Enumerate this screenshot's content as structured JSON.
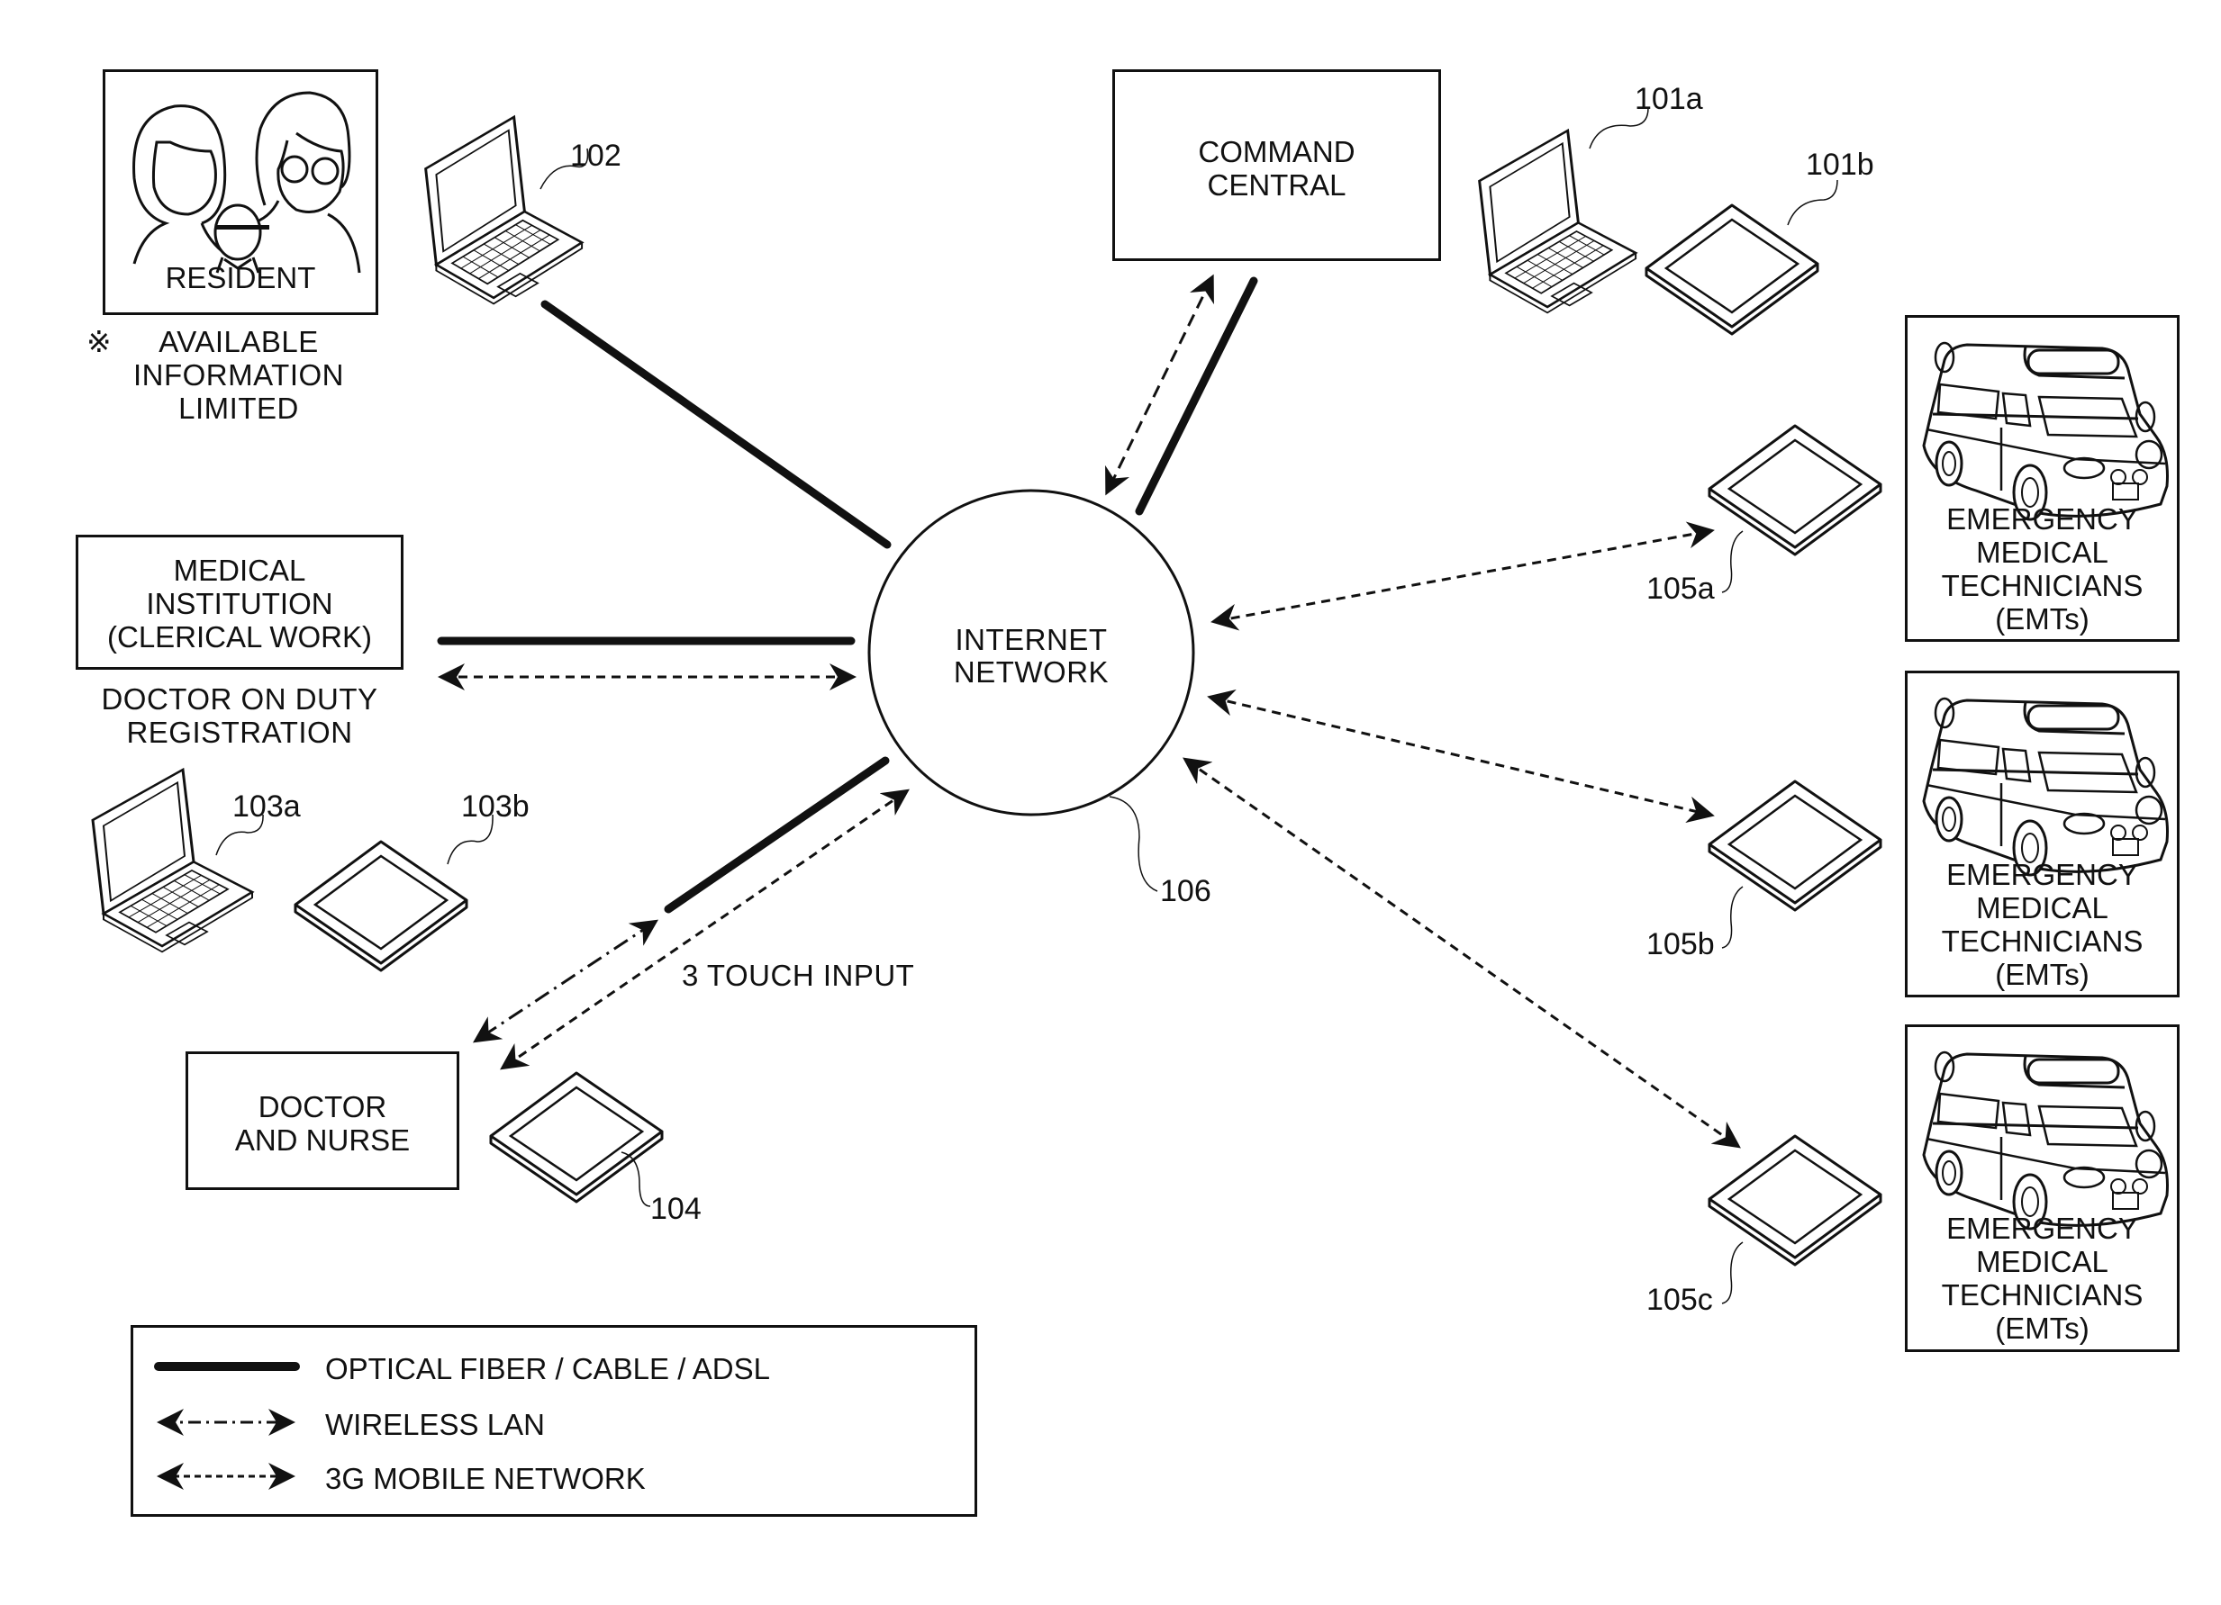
{
  "diagram": {
    "type": "network-system-diagram",
    "center": {
      "label_lines": [
        "INTERNET",
        "NETWORK"
      ],
      "ref": "106"
    },
    "nodes": {
      "resident": {
        "label": "RESIDENT",
        "note_symbol": "※",
        "note_lines": [
          "AVAILABLE",
          "INFORMATION",
          "LIMITED"
        ],
        "device_ref": "102",
        "device_type": "laptop-icon",
        "connection": "optical-fiber"
      },
      "command_central": {
        "label_lines": [
          "COMMAND",
          "CENTRAL"
        ],
        "devices": [
          {
            "ref": "101a",
            "type": "laptop-icon"
          },
          {
            "ref": "101b",
            "type": "tablet-icon"
          }
        ],
        "connections": [
          "optical-fiber",
          "3g-mobile"
        ]
      },
      "medical_institution": {
        "label_lines": [
          "MEDICAL",
          "INSTITUTION",
          "(CLERICAL WORK)"
        ],
        "caption_lines": [
          "DOCTOR ON DUTY",
          "REGISTRATION"
        ],
        "devices": [
          {
            "ref": "103a",
            "type": "laptop-icon"
          },
          {
            "ref": "103b",
            "type": "tablet-icon"
          }
        ],
        "connections": [
          "optical-fiber",
          "3g-mobile"
        ]
      },
      "doctor_nurse": {
        "label_lines": [
          "DOCTOR",
          "AND NURSE"
        ],
        "device_ref": "104",
        "device_type": "tablet-icon",
        "caption": "3 TOUCH INPUT",
        "connections": [
          "optical-fiber",
          "wireless-lan",
          "3g-mobile"
        ]
      },
      "emts": [
        {
          "label_lines": [
            "EMERGENCY",
            "MEDICAL",
            "TECHNICIANS",
            "(EMTs)"
          ],
          "device_ref": "105a",
          "icon": "ambulance-icon",
          "connection": "3g-mobile"
        },
        {
          "label_lines": [
            "EMERGENCY",
            "MEDICAL",
            "TECHNICIANS",
            "(EMTs)"
          ],
          "device_ref": "105b",
          "icon": "ambulance-icon",
          "connection": "3g-mobile"
        },
        {
          "label_lines": [
            "EMERGENCY",
            "MEDICAL",
            "TECHNICIANS",
            "(EMTs)"
          ],
          "device_ref": "105c",
          "icon": "ambulance-icon",
          "connection": "3g-mobile"
        }
      ]
    },
    "legend": [
      {
        "style": "solid-thick",
        "label": "OPTICAL FIBER / CABLE / ADSL"
      },
      {
        "style": "dash-dot-arrows",
        "label": "WIRELESS LAN"
      },
      {
        "style": "dashed-arrows",
        "label": "3G MOBILE NETWORK"
      }
    ],
    "colors": {
      "ink": "#111111",
      "background": "#ffffff"
    }
  }
}
